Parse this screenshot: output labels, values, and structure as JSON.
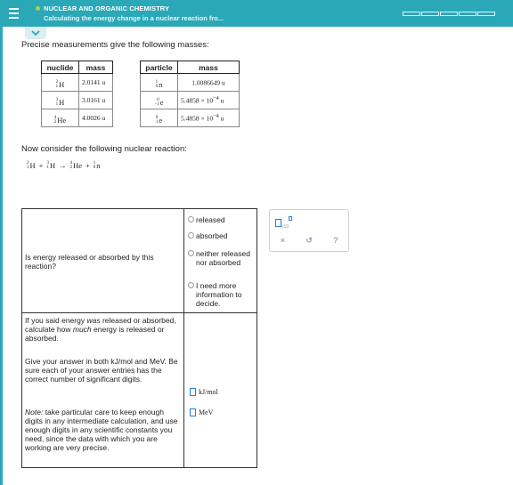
{
  "header": {
    "course": "NUCLEAR AND ORGANIC CHEMISTRY",
    "subtitle": "Calculating the energy change in a nuclear reaction fro...",
    "progress_segments": 5
  },
  "colors": {
    "brand": "#2aa8b8",
    "status_dot": "#9fd64a",
    "input_border": "#2a7fd4"
  },
  "intro": "Precise measurements give the following masses:",
  "table_left": {
    "headers": [
      "nuclide",
      "mass"
    ],
    "rows": [
      {
        "A": "2",
        "Z": "1",
        "sym": "H",
        "mass": "2.0141 u"
      },
      {
        "A": "3",
        "Z": "1",
        "sym": "H",
        "mass": "3.0161 u"
      },
      {
        "A": "4",
        "Z": "2",
        "sym": "He",
        "mass": "4.0026 u"
      }
    ]
  },
  "table_right": {
    "headers": [
      "particle",
      "mass"
    ],
    "rows": [
      {
        "A": "1",
        "Z": "0",
        "sym": "n",
        "mass_base": "1.0086649 u",
        "mass_exp": "",
        "mass_unit": ""
      },
      {
        "A": "0",
        "Z": "−1",
        "sym": "e",
        "mass_base": "5.4858 × 10",
        "mass_exp": "−4",
        "mass_unit": "u"
      },
      {
        "A": "0",
        "Z": "1",
        "sym": "e",
        "mass_base": "5.4858 × 10",
        "mass_exp": "−4",
        "mass_unit": "u"
      }
    ]
  },
  "reaction_prompt": "Now consider the following nuclear reaction:",
  "reaction": {
    "r1": {
      "A": "2",
      "Z": "1",
      "sym": "H"
    },
    "r2": {
      "A": "3",
      "Z": "1",
      "sym": "H"
    },
    "p1": {
      "A": "4",
      "Z": "2",
      "sym": "He"
    },
    "p2": {
      "A": "1",
      "Z": "0",
      "sym": "n"
    },
    "plus": "+",
    "arrow": "→"
  },
  "question1": {
    "text": "Is energy released or absorbed by this reaction?",
    "options": [
      "released",
      "absorbed",
      "neither released nor absorbed",
      "I need more information to decide."
    ]
  },
  "question2": {
    "p1_a": "If you said energy ",
    "p1_em": "was",
    "p1_b": " released or absorbed, calculate how ",
    "p1_em2": "much",
    "p1_c": " energy is released or absorbed.",
    "p2": "Give your answer in both kJ/mol and MeV. Be sure each of your answer entries has the correct number of significant digits.",
    "note_label": "Note:",
    "note": " take particular care to keep enough digits in any intermediate calculation, and use enough digits in any scientific constants you need, since the data with which you are working are very precise.",
    "unit1": "kJ/mol",
    "unit2": "MeV"
  },
  "tools": {
    "clear": "×",
    "undo": "↺",
    "help": "?",
    "x10": "x10"
  }
}
